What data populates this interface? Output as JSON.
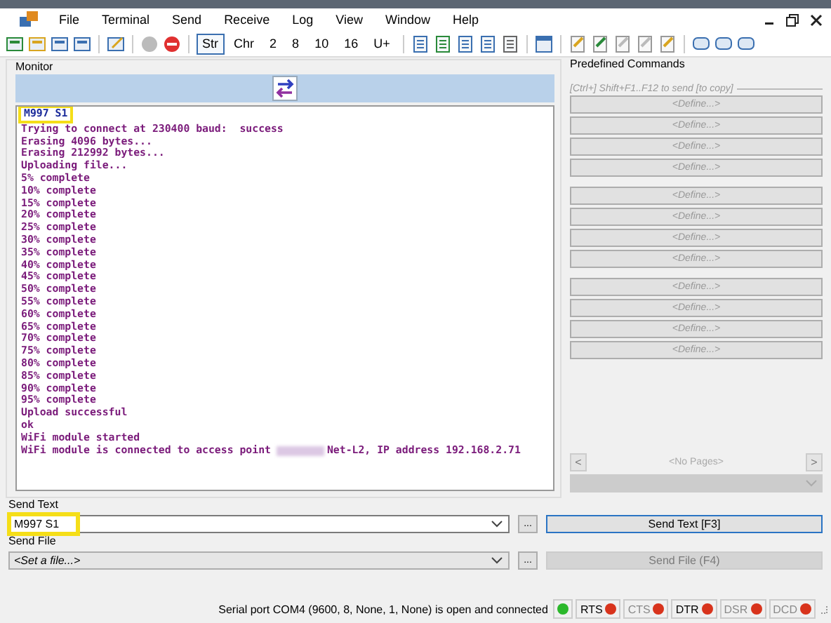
{
  "menu": [
    "File",
    "Terminal",
    "Send",
    "Receive",
    "Log",
    "View",
    "Window",
    "Help"
  ],
  "radix_buttons": [
    {
      "label": "Str",
      "selected": true
    },
    {
      "label": "Chr",
      "selected": false
    },
    {
      "label": "2",
      "selected": false
    },
    {
      "label": "8",
      "selected": false
    },
    {
      "label": "10",
      "selected": false
    },
    {
      "label": "16",
      "selected": false
    },
    {
      "label": "U+",
      "selected": false
    }
  ],
  "monitor": {
    "title": "Monitor",
    "lines": [
      {
        "kind": "sent",
        "text": "M997 S1",
        "highlighted": true
      },
      {
        "kind": "received",
        "text": "Trying to connect at 230400 baud:  success"
      },
      {
        "kind": "received",
        "text": "Erasing 4096 bytes..."
      },
      {
        "kind": "received",
        "text": "Erasing 212992 bytes..."
      },
      {
        "kind": "received",
        "text": "Uploading file..."
      },
      {
        "kind": "received",
        "text": "5% complete"
      },
      {
        "kind": "received",
        "text": "10% complete"
      },
      {
        "kind": "received",
        "text": "15% complete"
      },
      {
        "kind": "received",
        "text": "20% complete"
      },
      {
        "kind": "received",
        "text": "25% complete"
      },
      {
        "kind": "received",
        "text": "30% complete"
      },
      {
        "kind": "received",
        "text": "35% complete"
      },
      {
        "kind": "received",
        "text": "40% complete"
      },
      {
        "kind": "received",
        "text": "45% complete"
      },
      {
        "kind": "received",
        "text": "50% complete"
      },
      {
        "kind": "received",
        "text": "55% complete"
      },
      {
        "kind": "received",
        "text": "60% complete"
      },
      {
        "kind": "received",
        "text": "65% complete"
      },
      {
        "kind": "received",
        "text": "70% complete"
      },
      {
        "kind": "received",
        "text": "75% complete"
      },
      {
        "kind": "received",
        "text": "80% complete"
      },
      {
        "kind": "received",
        "text": "85% complete"
      },
      {
        "kind": "received",
        "text": "90% complete"
      },
      {
        "kind": "received",
        "text": "95% complete"
      },
      {
        "kind": "received",
        "text": "Upload successful"
      },
      {
        "kind": "received",
        "text": "ok"
      },
      {
        "kind": "received",
        "text": "WiFi module started"
      },
      {
        "kind": "redacted",
        "before": "WiFi module is connected to access point",
        "after": "Net-L2, IP address 192.168.2.71"
      }
    ]
  },
  "predefined": {
    "title": "Predefined Commands",
    "hint": "[Ctrl+] Shift+F1..F12 to send [to copy]",
    "groups": [
      [
        "<Define...>",
        "<Define...>",
        "<Define...>",
        "<Define...>"
      ],
      [
        "<Define...>",
        "<Define...>",
        "<Define...>",
        "<Define...>"
      ],
      [
        "<Define...>",
        "<Define...>",
        "<Define...>",
        "<Define...>"
      ]
    ],
    "prev": "<",
    "pages": "<No Pages>",
    "next": ">"
  },
  "send_text": {
    "title": "Send Text",
    "value": "M997 S1",
    "highlighted": true,
    "browse": "...",
    "button": "Send Text [F3]",
    "button_disabled": false
  },
  "send_file": {
    "title": "Send File",
    "value": "<Set a file...>",
    "browse": "...",
    "button": "Send File (F4)",
    "button_disabled": true
  },
  "status_bar": {
    "text": "Serial port COM4 (9600, 8, None, 1, None) is open and connected",
    "connected": true,
    "signals": [
      {
        "label": "RTS",
        "enabled": true
      },
      {
        "label": "CTS",
        "enabled": false
      },
      {
        "label": "DTR",
        "enabled": true
      },
      {
        "label": "DSR",
        "enabled": false
      },
      {
        "label": "DCD",
        "enabled": false
      }
    ]
  }
}
